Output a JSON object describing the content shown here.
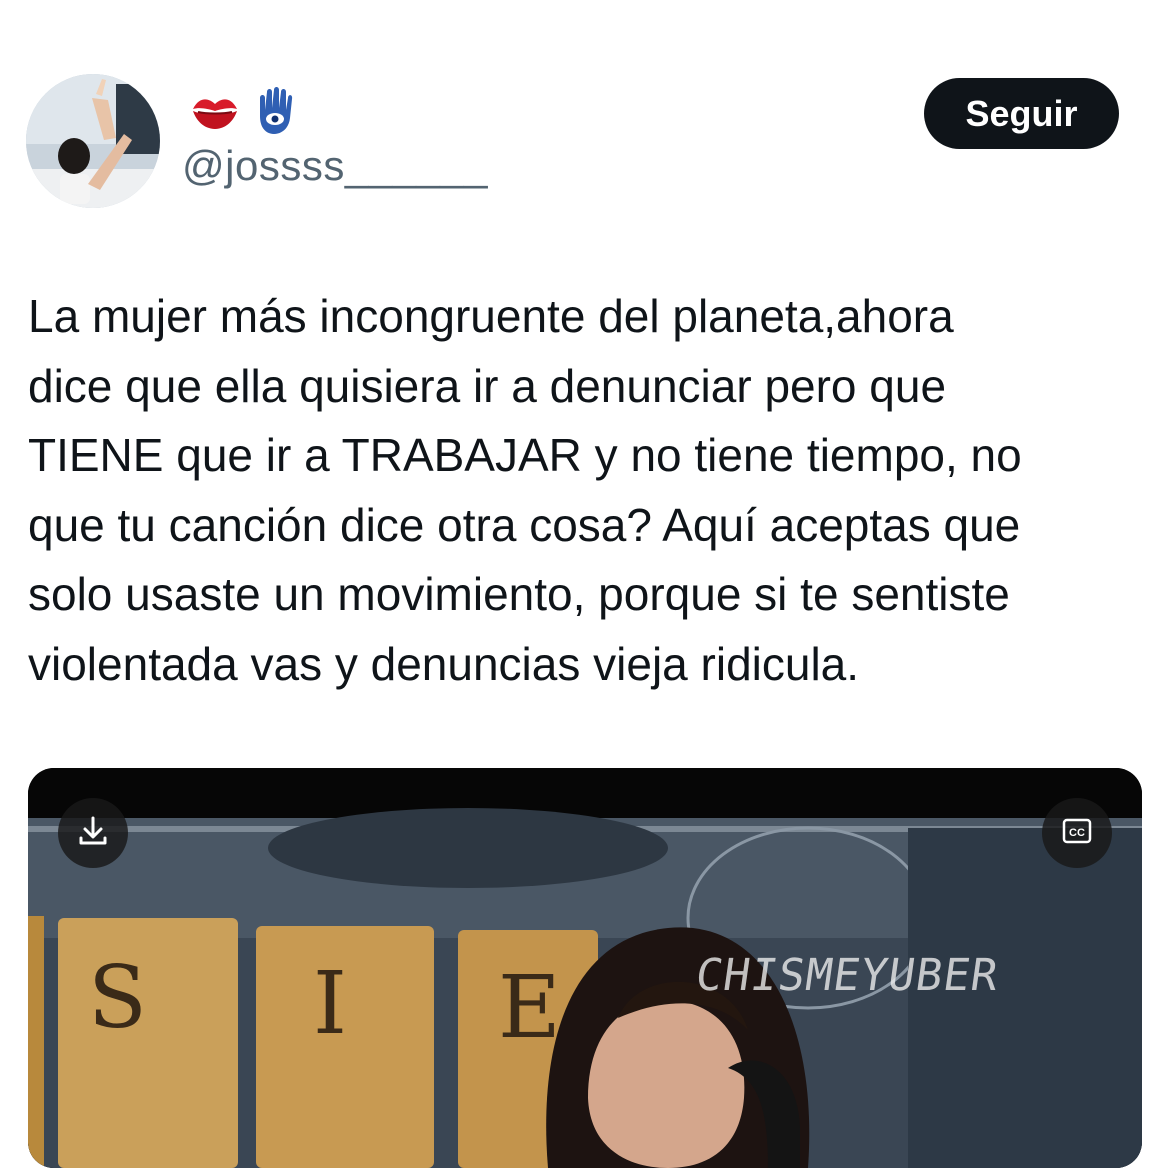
{
  "author": {
    "handle": "@jossss______",
    "name_emojis": [
      "kiss-mark-icon",
      "hamsa-icon"
    ]
  },
  "follow_button": {
    "label": "Seguir"
  },
  "tweet": {
    "text": "La mujer más incongruente del planeta,ahora\ndice que ella quisiera ir a denunciar pero que\nTIENE que ir a TRABAJAR y no tiene tiempo, no\nque tu canción dice otra cosa? Aquí aceptas que\nsolo usaste un movimiento, porque si te sentiste\nviolentada vas y denuncias vieja ridicula."
  },
  "media": {
    "type": "video",
    "watermark": "CHISMEYUBER",
    "tile_letters": [
      "S",
      "I",
      "E"
    ],
    "controls": [
      "download-icon",
      "closed-captions-icon"
    ]
  },
  "colors": {
    "text": "#0f1419",
    "secondary_text": "#536471",
    "button_bg": "#0f1419",
    "button_text": "#ffffff"
  }
}
